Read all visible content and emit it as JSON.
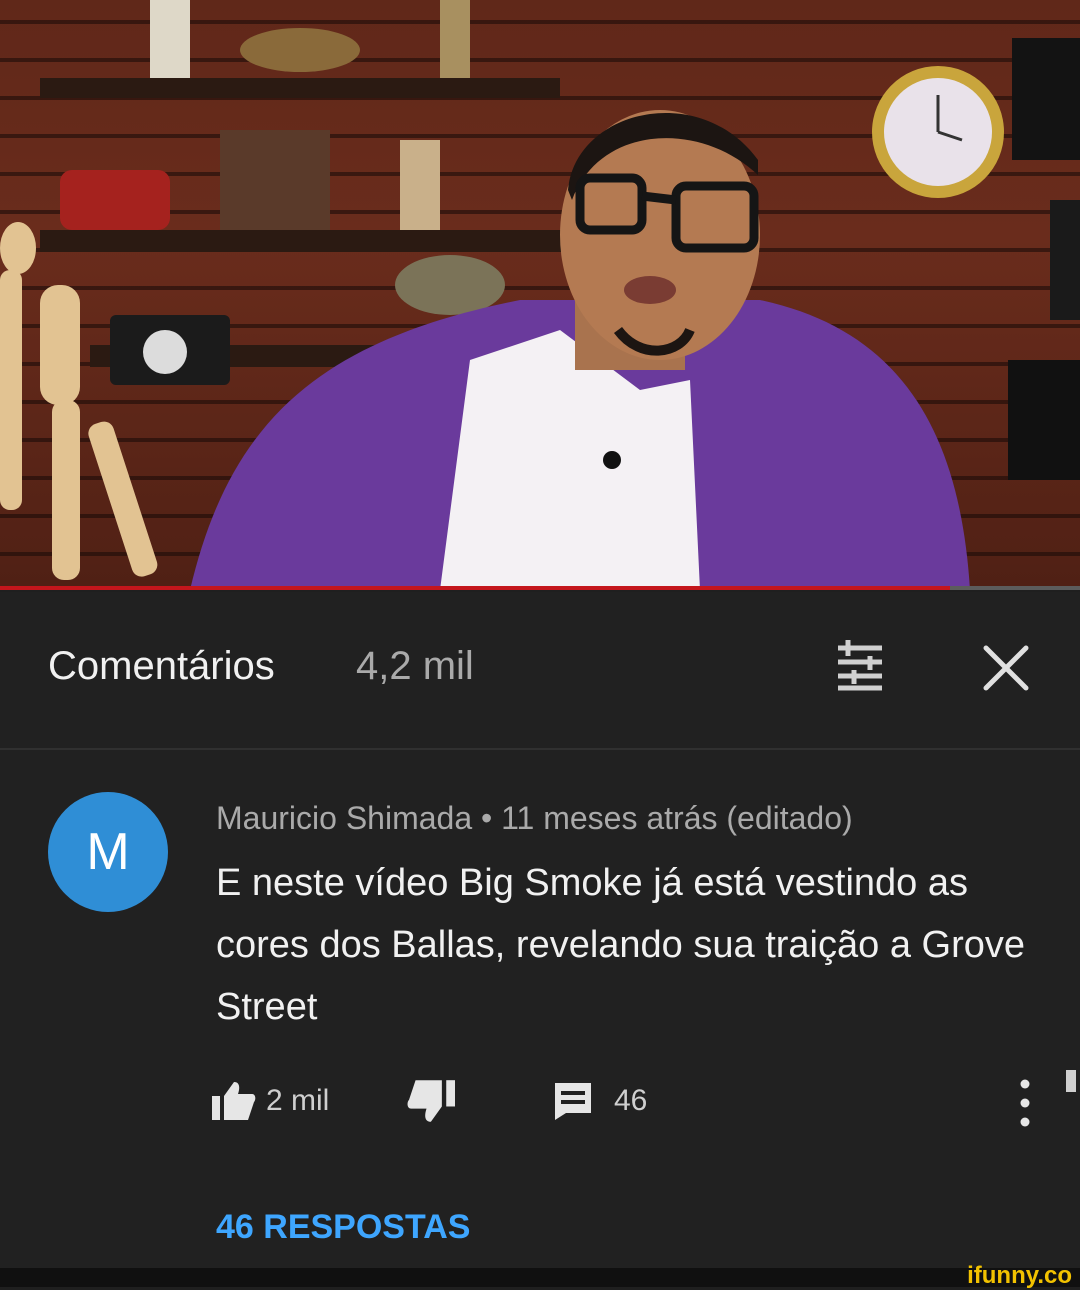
{
  "video": {
    "progress_fraction": 0.88,
    "accent_color": "#c4161c"
  },
  "header": {
    "title": "Comentários",
    "count": "4,2 mil",
    "sort_icon": "sort-filter-icon",
    "close_icon": "close-icon"
  },
  "comment": {
    "avatar_letter": "M",
    "avatar_color": "#2f8ed6",
    "meta": "Mauricio Shimada • 11 meses atrás (editado)",
    "text": "E neste vídeo Big Smoke já está vestindo as cores dos Ballas, revelando sua traição a Grove Street",
    "likes": "2 mil",
    "replies_count": "46",
    "replies_link": "46 RESPOSTAS",
    "link_color": "#3ea6ff"
  },
  "watermark": "ifunny.co"
}
